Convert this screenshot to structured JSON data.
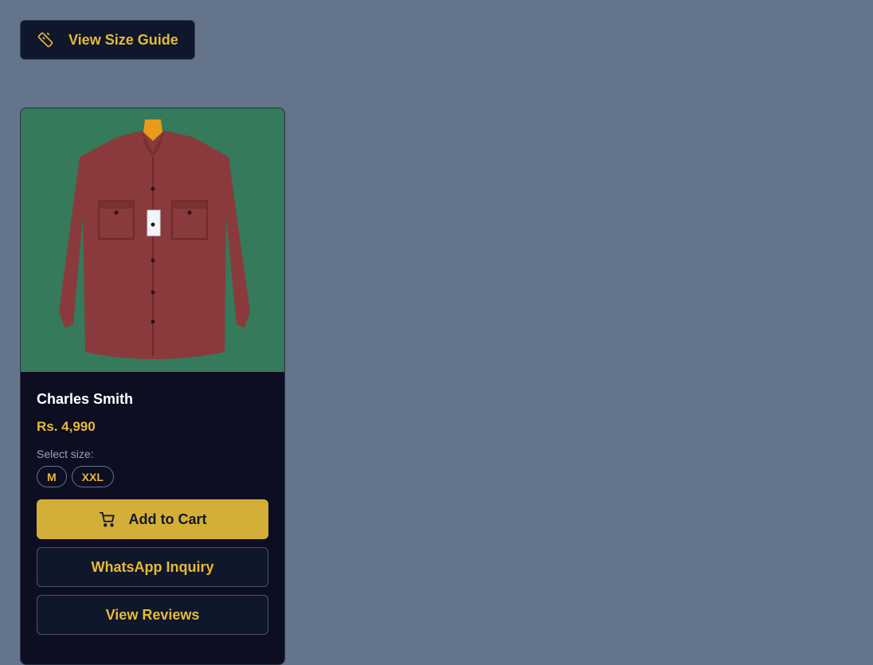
{
  "size_guide": {
    "label": "View Size Guide",
    "icon": "ruler-icon"
  },
  "product": {
    "name": "Charles Smith",
    "price": "Rs. 4,990",
    "size_label": "Select size:",
    "sizes": [
      "M",
      "XXL"
    ],
    "image_alt": "maroon button-down shirt on hanger"
  },
  "actions": {
    "add_to_cart": "Add to Cart",
    "whatsapp": "WhatsApp Inquiry",
    "reviews": "View Reviews"
  },
  "colors": {
    "background": "#64748b",
    "accent_gold": "#d4af37",
    "card_bg": "#0e0e22",
    "image_bg": "#357a5a"
  }
}
